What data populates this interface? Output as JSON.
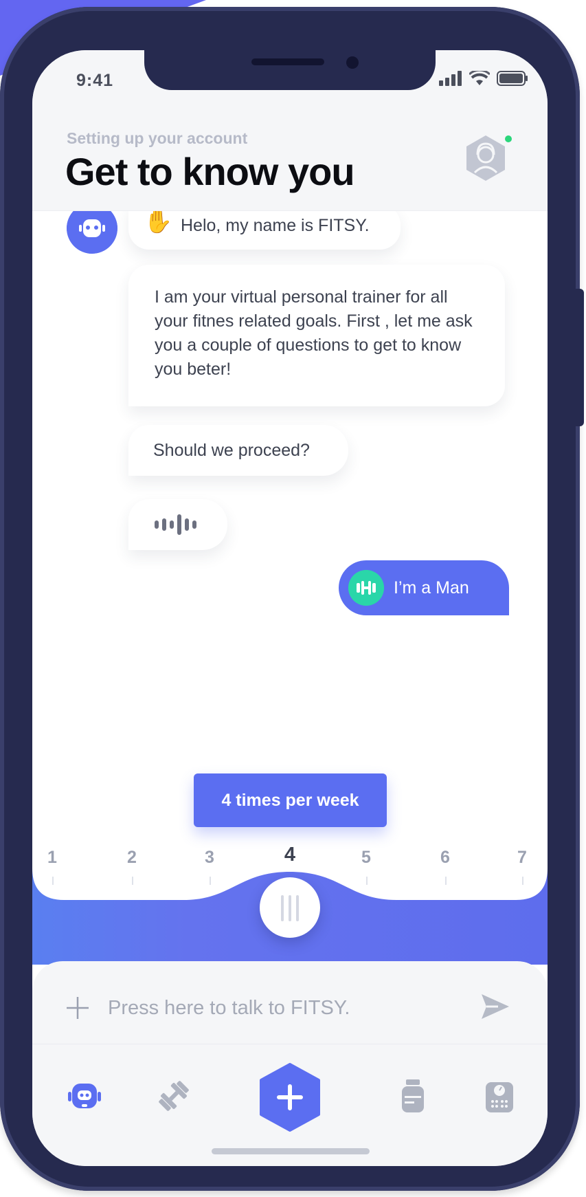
{
  "status_bar": {
    "time": "9:41"
  },
  "header": {
    "subtitle": "Setting up your account",
    "title": "Get to know you"
  },
  "chat": {
    "messages": [
      {
        "from": "bot",
        "text": "Helo, my name is FITSY."
      },
      {
        "from": "bot",
        "text": "I am your virtual personal trainer for all your fitnes related goals. First , let me ask you a couple of questions to get to know you beter!"
      },
      {
        "from": "bot",
        "text": "Should we proceed?"
      }
    ],
    "reply": {
      "text": "I’m a Man",
      "icon": "dumbbell-icon"
    }
  },
  "slider": {
    "tooltip": "4 times per week",
    "labels": [
      "1",
      "2",
      "3",
      "4",
      "5",
      "6",
      "7"
    ],
    "selected": 4
  },
  "composer": {
    "placeholder": "Press here to talk to FITSY."
  },
  "tabbar": {
    "items": [
      "robot-icon",
      "dumbbell-icon",
      "add-icon",
      "supplement-icon",
      "scale-icon"
    ],
    "active": "robot-icon"
  },
  "colors": {
    "accent": "#5b6ef1",
    "teal": "#2ad6a9",
    "online": "#2bd67b",
    "phone_frame": "#262a4f"
  }
}
